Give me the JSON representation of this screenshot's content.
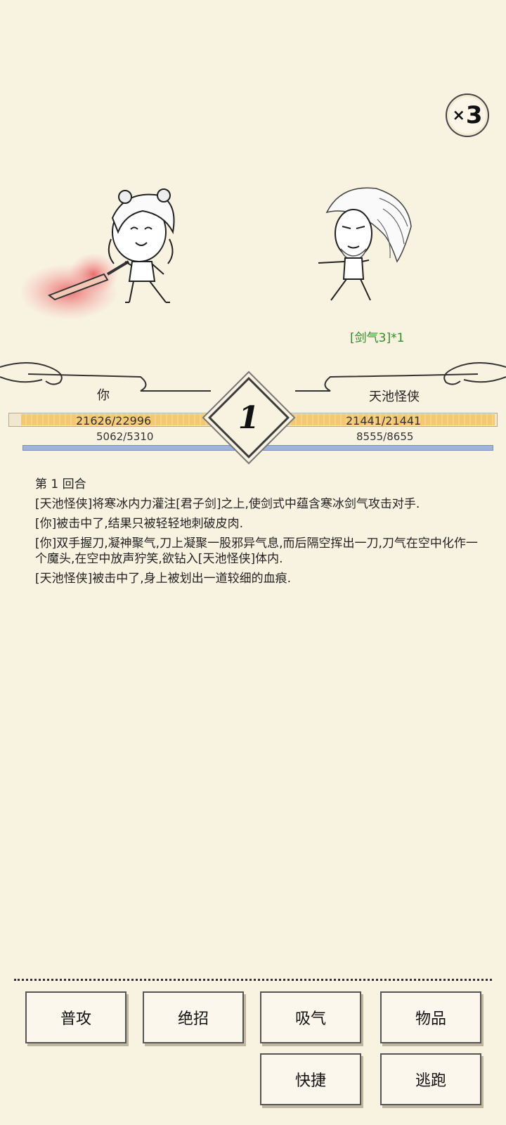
{
  "speed": {
    "multiplier_prefix": "×",
    "multiplier_value": "3"
  },
  "player": {
    "name": "你",
    "hp": "21626/22996",
    "hp_fraction": 0.94,
    "mp": "5062/5310"
  },
  "enemy": {
    "name": "天池怪侠",
    "hp": "21441/21441",
    "hp_fraction": 1.0,
    "mp": "8555/8655",
    "status": "[剑气3]*1"
  },
  "round_badge": "1",
  "log": [
    "第 1 回合",
    "[天池怪侠]将寒冰内力灌注[君子剑]之上,使剑式中蕴含寒冰剑气攻击对手.",
    "[你]被击中了,结果只被轻轻地刺破皮肉.",
    "[你]双手握刀,凝神聚气,刀上凝聚一股邪异气息,而后隔空挥出一刀,刀气在空中化作一个魔头,在空中放声狞笑,欲钻入[天池怪侠]体内.",
    "[天池怪侠]被击中了,身上被划出一道较细的血痕."
  ],
  "actions": {
    "attack": "普攻",
    "ultimate": "绝招",
    "absorb": "吸气",
    "items": "物品",
    "shortcut": "快捷",
    "flee": "逃跑"
  }
}
